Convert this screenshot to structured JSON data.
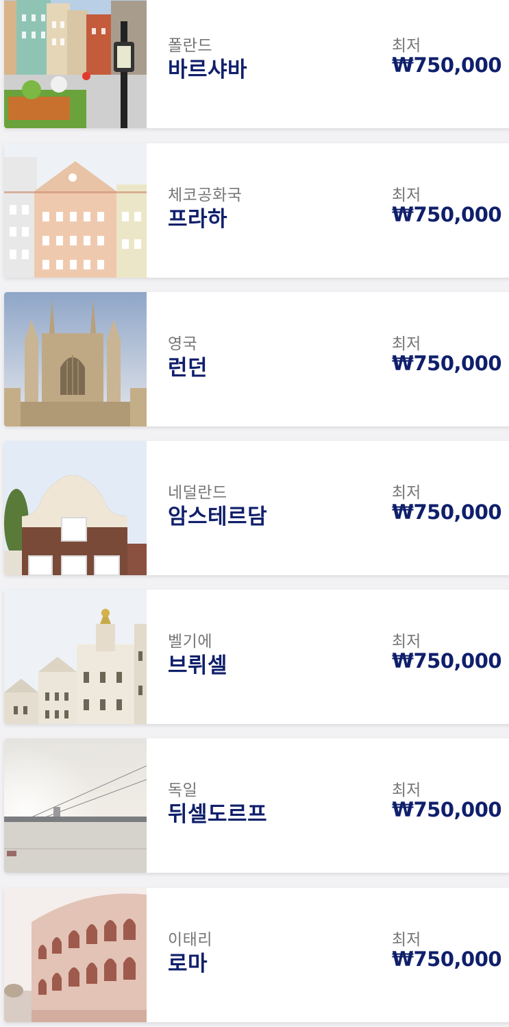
{
  "destinations": [
    {
      "country": "폴란드",
      "city": "바르샤바",
      "from_label": "최저",
      "price": "₩750,000",
      "image": "warsaw-old-town-photo"
    },
    {
      "country": "체코공화국",
      "city": "프라하",
      "from_label": "최저",
      "price": "₩750,000",
      "image": "prague-facades-photo"
    },
    {
      "country": "영국",
      "city": "런던",
      "from_label": "최저",
      "price": "₩750,000",
      "image": "london-gothic-cathedral-photo"
    },
    {
      "country": "네덜란드",
      "city": "암스테르담",
      "from_label": "최저",
      "price": "₩750,000",
      "image": "amsterdam-gable-house-photo"
    },
    {
      "country": "벨기에",
      "city": "브뤼셀",
      "from_label": "최저",
      "price": "₩750,000",
      "image": "brussels-grand-place-photo"
    },
    {
      "country": "독일",
      "city": "뒤셀도르프",
      "from_label": "최저",
      "price": "₩750,000",
      "image": "dusseldorf-rhine-bridge-photo"
    },
    {
      "country": "이태리",
      "city": "로마",
      "from_label": "최저",
      "price": "₩750,000",
      "image": "rome-colosseum-photo"
    }
  ],
  "colors": {
    "city_text": "#0f1f6b",
    "price_text": "#0f1f6b",
    "label_text": "#757575",
    "card_bg": "#ffffff",
    "page_bg": "#f2f2f4"
  }
}
